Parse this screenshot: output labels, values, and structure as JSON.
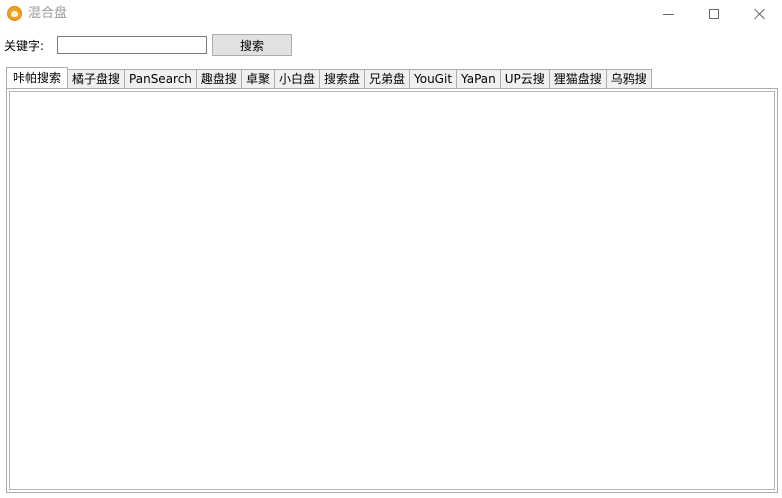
{
  "window": {
    "title": "混合盘",
    "icon": "app-logo-icon"
  },
  "search": {
    "label": "关键字:",
    "value": "",
    "placeholder": "",
    "button_label": "搜索"
  },
  "tabs": [
    {
      "label": "咔帕搜索",
      "active": true
    },
    {
      "label": "橘子盘搜",
      "active": false
    },
    {
      "label": "PanSearch",
      "active": false
    },
    {
      "label": "趣盘搜",
      "active": false
    },
    {
      "label": "卓聚",
      "active": false
    },
    {
      "label": "小白盘",
      "active": false
    },
    {
      "label": "搜索盘",
      "active": false
    },
    {
      "label": "兄弟盘",
      "active": false
    },
    {
      "label": "YouGit",
      "active": false
    },
    {
      "label": "YaPan",
      "active": false
    },
    {
      "label": "UP云搜",
      "active": false
    },
    {
      "label": "狸猫盘搜",
      "active": false
    },
    {
      "label": "乌鸦搜",
      "active": false
    }
  ],
  "colors": {
    "accent": "#f0a020",
    "title_text": "#999999",
    "button_face": "#e1e1e1",
    "tab_inactive": "#f0f0f0"
  }
}
